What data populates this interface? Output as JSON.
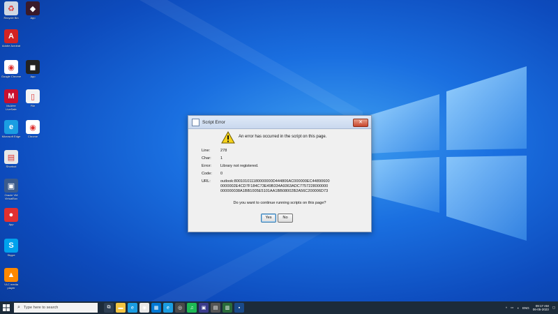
{
  "desktop": {
    "icons": [
      {
        "name": "recycle-bin-icon",
        "label": "Recycle Bin",
        "color": "#cfd8e3",
        "glyph": "♻"
      },
      {
        "name": "adobe-acrobat-icon",
        "label": "Adobe Acrobat",
        "color": "#d42323",
        "glyph": "A"
      },
      {
        "name": "google-chrome-icon",
        "label": "Google Chrome",
        "color": "#ffffff",
        "glyph": "◉"
      },
      {
        "name": "mcafee-icon",
        "label": "McAfee LiveSafe",
        "color": "#c8102e",
        "glyph": "M"
      },
      {
        "name": "microsoft-edge-icon",
        "label": "Microsoft Edge",
        "color": "#1b9de2",
        "glyph": "e"
      },
      {
        "name": "shortcut-icon",
        "label": "Shortcut",
        "color": "#e8e8e8",
        "glyph": "▤"
      },
      {
        "name": "virtualbox-icon",
        "label": "Oracle VM VirtualBox",
        "color": "#3b5b8c",
        "glyph": "▣"
      },
      {
        "name": "app-red-icon",
        "label": "App",
        "color": "#e03030",
        "glyph": "●"
      },
      {
        "name": "skype-icon",
        "label": "Skype",
        "color": "#00a2ed",
        "glyph": "S"
      },
      {
        "name": "vlc-icon",
        "label": "VLC media player",
        "color": "#ff8800",
        "glyph": "▲"
      }
    ],
    "icons_col2": [
      {
        "name": "app-dark-icon",
        "label": "App",
        "color": "#3a1a2a",
        "glyph": "◆"
      },
      {
        "name": "app-black-icon",
        "label": "App",
        "color": "#222222",
        "glyph": "◼"
      },
      {
        "name": "file-icon",
        "label": "File",
        "color": "#f3f3f3",
        "glyph": "▯"
      },
      {
        "name": "chrome-shortcut-icon",
        "label": "Chrome",
        "color": "#ffffff",
        "glyph": "◉"
      }
    ]
  },
  "dialog": {
    "title": "Script Error",
    "close_label": "✕",
    "message": "An error has occurred in the script on this page.",
    "rows": [
      {
        "key": "Line:",
        "value": "278"
      },
      {
        "key": "Char:",
        "value": "1"
      },
      {
        "key": "Error:",
        "value": "Library not registered."
      },
      {
        "key": "Code:",
        "value": "0"
      }
    ],
    "url_key": "URL:",
    "url_lines": [
      "outlook:800101011180000000D444806AC000000EC44890600",
      "0000002E4CD7F184C73E49B334A9363ADC7757228000000",
      "000000038A1BB1005E5101AA1BB08002B2A56C200006D73"
    ],
    "question": "Do you want to continue running scripts on this page?",
    "yes_label": "Yes",
    "no_label": "No"
  },
  "taskbar": {
    "search_placeholder": "Type here to search",
    "apps": [
      {
        "name": "task-view-icon",
        "color": "#2e3f52",
        "glyph": "⧉"
      },
      {
        "name": "file-explorer-icon",
        "color": "#f4c542",
        "glyph": "▬"
      },
      {
        "name": "edge-taskbar-icon",
        "color": "#1b9de2",
        "glyph": "e"
      },
      {
        "name": "chrome-taskbar-icon",
        "color": "#e8e8e8",
        "glyph": "◉"
      },
      {
        "name": "store-taskbar-icon",
        "color": "#0078d4",
        "glyph": "▦"
      },
      {
        "name": "edge-dev-taskbar-icon",
        "color": "#1b9de2",
        "glyph": "e"
      },
      {
        "name": "xbox-taskbar-icon",
        "color": "#4a4a4a",
        "glyph": "◎"
      },
      {
        "name": "spotify-taskbar-icon",
        "color": "#1db954",
        "glyph": "♫"
      },
      {
        "name": "app-taskbar-icon",
        "color": "#3b3b8c",
        "glyph": "▣"
      },
      {
        "name": "app2-taskbar-icon",
        "color": "#555555",
        "glyph": "▤"
      },
      {
        "name": "app3-taskbar-icon",
        "color": "#2a6b3a",
        "glyph": "▥"
      },
      {
        "name": "ie-taskbar-icon",
        "color": "#1a4a8a",
        "glyph": "▪"
      }
    ],
    "tray_lang": "ENG",
    "time": "09:17 AM",
    "date": "06-05-2023"
  }
}
